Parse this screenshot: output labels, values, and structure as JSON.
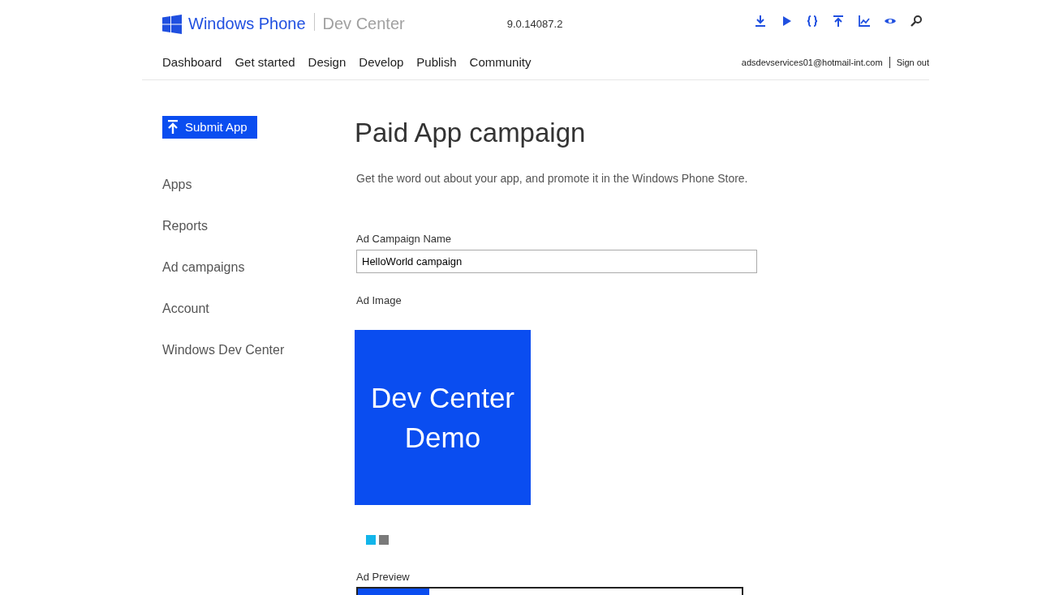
{
  "header": {
    "brand": "Windows Phone",
    "product": "Dev Center",
    "version": "9.0.14087.2",
    "toolbar": [
      {
        "kind": "download"
      },
      {
        "kind": "play"
      },
      {
        "kind": "braces"
      },
      {
        "kind": "upload"
      },
      {
        "kind": "chart"
      },
      {
        "kind": "eye"
      },
      {
        "kind": "search"
      }
    ],
    "nav": [
      "Dashboard",
      "Get started",
      "Design",
      "Develop",
      "Publish",
      "Community"
    ],
    "user": "adsdevservices01@hotmail-int.com",
    "sign_out": "Sign out"
  },
  "sidebar": {
    "submit_button": "Submit App",
    "items": [
      "Apps",
      "Reports",
      "Ad campaigns",
      "Account",
      "Windows Dev Center"
    ]
  },
  "main": {
    "title": "Paid App campaign",
    "intro": "Get the word out about your app, and promote it in the Windows Phone Store.",
    "name_label": "Ad Campaign Name",
    "name_value": "HelloWorld campaign",
    "image_label": "Ad Image",
    "image_text": "Dev Center Demo",
    "carousel": [
      {
        "selected": true
      },
      {
        "selected": false
      }
    ],
    "preview_label": "Ad Preview"
  }
}
